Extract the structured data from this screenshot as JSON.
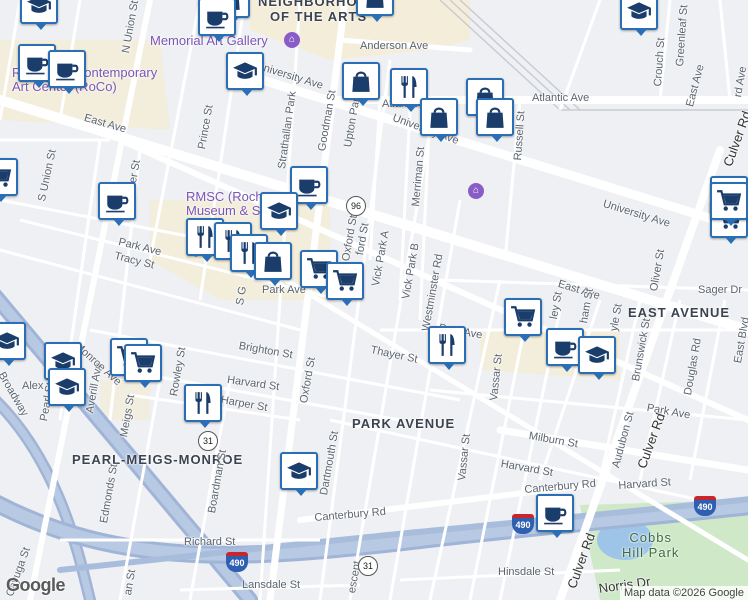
{
  "map": {
    "areas": [
      {
        "id": "neighborhood-of-the-arts",
        "text": "NEIGHBORHOOD\nOF THE ARTS"
      },
      {
        "id": "east-avenue",
        "text": "EAST AVENUE"
      },
      {
        "id": "park-avenue",
        "text": "PARK AVENUE"
      },
      {
        "id": "pearl-meigs-monroe",
        "text": "PEARL-MEIGS-MONROE"
      },
      {
        "id": "cobbs-hill-park",
        "text": "Cobbs\nHill Park"
      }
    ],
    "pois": [
      {
        "id": "memorial-art-gallery",
        "text": "Memorial Art Gallery"
      },
      {
        "id": "roco",
        "text": "Rochester Contemporary\nArt Center (RoCo)"
      },
      {
        "id": "rmsc",
        "text": "RMSC (Rochester\nMuseum & Science"
      }
    ],
    "streets": [
      {
        "id": "anderson-ave",
        "text": "Anderson Ave"
      },
      {
        "id": "university-ave-1",
        "text": "University Ave"
      },
      {
        "id": "university-ave-2",
        "text": "University Ave"
      },
      {
        "id": "university-ave-3",
        "text": "University Ave"
      },
      {
        "id": "atlantic-ave-1",
        "text": "Atlantic"
      },
      {
        "id": "atlantic-ave-2",
        "text": "Atlantic Ave"
      },
      {
        "id": "east-ave-1",
        "text": "East Ave"
      },
      {
        "id": "east-ave-2",
        "text": "East Ave"
      },
      {
        "id": "east-ave-3",
        "text": "East Ave"
      },
      {
        "id": "n-union-st",
        "text": "N Union St"
      },
      {
        "id": "s-union-st",
        "text": "S Union St"
      },
      {
        "id": "prince-st",
        "text": "Prince St"
      },
      {
        "id": "strathallan-park",
        "text": "Strathallan Park"
      },
      {
        "id": "goodman-st",
        "text": "Goodman St"
      },
      {
        "id": "upton-park",
        "text": "Upton Park"
      },
      {
        "id": "merriman-st",
        "text": "Merriman St"
      },
      {
        "id": "russell-st",
        "text": "Russell St"
      },
      {
        "id": "crouch-st",
        "text": "Crouch St"
      },
      {
        "id": "greenleaf-st",
        "text": "Greenleaf St"
      },
      {
        "id": "park-ave-1",
        "text": "Park Ave"
      },
      {
        "id": "park-ave-2",
        "text": "Park Ave"
      },
      {
        "id": "park-ave-3",
        "text": "Park Ave"
      },
      {
        "id": "tracy-st",
        "text": "Tracy St"
      },
      {
        "id": "vick-park-a",
        "text": "Vick Park A"
      },
      {
        "id": "vick-park-b",
        "text": "Vick Park B"
      },
      {
        "id": "westminster-rd",
        "text": "Westminster Rd"
      },
      {
        "id": "oxford-st-1",
        "text": "Oxford St"
      },
      {
        "id": "oxford-st-2",
        "text": "Oxford St"
      },
      {
        "id": "brighton-st",
        "text": "Brighton St"
      },
      {
        "id": "thayer-st",
        "text": "Thayer St"
      },
      {
        "id": "harvard-st-1",
        "text": "Harvard St"
      },
      {
        "id": "harvard-st-2",
        "text": "Harvard St"
      },
      {
        "id": "harvard-st-3",
        "text": "Harvard St"
      },
      {
        "id": "harper-st",
        "text": "Harper St"
      },
      {
        "id": "rowley-st",
        "text": "Rowley St"
      },
      {
        "id": "meigs-st",
        "text": "Meigs St"
      },
      {
        "id": "averill-ave",
        "text": "Averill Ave"
      },
      {
        "id": "pearl-st",
        "text": "Pearl St"
      },
      {
        "id": "monroe-ave",
        "text": "Monroe Ave"
      },
      {
        "id": "broadway",
        "text": "Broadway"
      },
      {
        "id": "vassar-st-1",
        "text": "Vassar St"
      },
      {
        "id": "vassar-st-2",
        "text": "Vassar St"
      },
      {
        "id": "milburn-st",
        "text": "Milburn St"
      },
      {
        "id": "canterbury-rd-1",
        "text": "Canterbury Rd"
      },
      {
        "id": "canterbury-rd-2",
        "text": "Canterbury Rd"
      },
      {
        "id": "edmonds-st",
        "text": "Edmonds St"
      },
      {
        "id": "boardman-st",
        "text": "Boardman St"
      },
      {
        "id": "dartmouth-st",
        "text": "Dartmouth St"
      },
      {
        "id": "richard-st",
        "text": "Richard St"
      },
      {
        "id": "lansdale-st",
        "text": "Lansdale St"
      },
      {
        "id": "hinsdale-st",
        "text": "Hinsdale St"
      },
      {
        "id": "norris-dr",
        "text": "Norris Dr"
      },
      {
        "id": "culver-rd-1",
        "text": "Culver Rd"
      },
      {
        "id": "culver-rd-2",
        "text": "Culver Rd"
      },
      {
        "id": "culver-rd-3",
        "text": "Culver Rd"
      },
      {
        "id": "audubon-st",
        "text": "Audubon St"
      },
      {
        "id": "brunswick-st",
        "text": "Brunswick St"
      },
      {
        "id": "douglas-rd",
        "text": "Douglas Rd"
      },
      {
        "id": "oliver-st",
        "text": "Oliver St"
      },
      {
        "id": "sager-dr",
        "text": "Sager Dr"
      },
      {
        "id": "east-blvd",
        "text": "East Blvd"
      },
      {
        "id": "s-goodman",
        "text": "S G"
      },
      {
        "id": "alex",
        "text": "Alex"
      },
      {
        "id": "cayuga",
        "text": "Cayuga St"
      },
      {
        "id": "crescent",
        "text": "escent"
      },
      {
        "id": "an-st",
        "text": "an St"
      },
      {
        "id": "ford-st",
        "text": "ford St"
      },
      {
        "id": "mu",
        "text": "M"
      },
      {
        "id": "der-st",
        "text": "der St"
      },
      {
        "id": "rd-ave",
        "text": "rd Ave"
      },
      {
        "id": "ley-st",
        "text": "ley St"
      },
      {
        "id": "ham-st",
        "text": "ham St"
      },
      {
        "id": "yle-st",
        "text": "yle St"
      },
      {
        "id": "park-ave-4",
        "text": "Park Ave"
      }
    ],
    "shields": [
      {
        "id": "route-96",
        "text": "96"
      },
      {
        "id": "route-31-1",
        "text": "31"
      },
      {
        "id": "route-31-2",
        "text": "31"
      },
      {
        "id": "i490-1",
        "text": "490"
      },
      {
        "id": "i490-2",
        "text": "490"
      },
      {
        "id": "i490-3",
        "text": "490"
      }
    ],
    "markers": [
      {
        "id": "m1",
        "icon": "school-icon"
      },
      {
        "id": "m2",
        "icon": "shopping-bag-icon"
      },
      {
        "id": "m3",
        "icon": "shopping-bag-icon"
      },
      {
        "id": "m4",
        "icon": "school-icon"
      },
      {
        "id": "m5",
        "icon": "cafe-icon"
      },
      {
        "id": "m6",
        "icon": "cafe-icon"
      },
      {
        "id": "m7",
        "icon": "school-icon"
      },
      {
        "id": "m8",
        "icon": "shopping-bag-icon"
      },
      {
        "id": "m9",
        "icon": "restaurant-icon"
      },
      {
        "id": "m10",
        "icon": "shopping-bag-icon"
      },
      {
        "id": "m11",
        "icon": "shopping-bag-icon"
      },
      {
        "id": "m12",
        "icon": "shopping-bag-icon"
      },
      {
        "id": "m13",
        "icon": "shopping-cart-icon"
      },
      {
        "id": "m14",
        "icon": "cafe-icon"
      },
      {
        "id": "m15",
        "icon": "cafe-icon"
      },
      {
        "id": "m16",
        "icon": "school-icon"
      },
      {
        "id": "m17",
        "icon": "shopping-bag-icon"
      },
      {
        "id": "m18",
        "icon": "restaurant-icon"
      },
      {
        "id": "m19",
        "icon": "restaurant-icon"
      },
      {
        "id": "m20",
        "icon": "restaurant-icon"
      },
      {
        "id": "m21",
        "icon": "shopping-bag-icon"
      },
      {
        "id": "m22",
        "icon": "shopping-cart-icon"
      },
      {
        "id": "m23",
        "icon": "shopping-cart-icon"
      },
      {
        "id": "m24",
        "icon": "school-icon"
      },
      {
        "id": "m25",
        "icon": "school-icon"
      },
      {
        "id": "m26",
        "icon": "school-icon"
      },
      {
        "id": "m27",
        "icon": "restaurant-icon"
      },
      {
        "id": "m28",
        "icon": "shopping-cart-icon"
      },
      {
        "id": "m29",
        "icon": "shopping-cart-icon"
      },
      {
        "id": "m30",
        "icon": "shopping-cart-icon"
      },
      {
        "id": "m31",
        "icon": "restaurant-icon"
      },
      {
        "id": "m32",
        "icon": "school-icon"
      },
      {
        "id": "m33",
        "icon": "cafe-icon"
      },
      {
        "id": "m34",
        "icon": "school-icon"
      },
      {
        "id": "m35",
        "icon": "shopping-cart-icon"
      },
      {
        "id": "m36",
        "icon": "cafe-icon"
      },
      {
        "id": "m37",
        "icon": "cafe-icon"
      },
      {
        "id": "m38",
        "icon": "shopping-cart-icon"
      }
    ]
  },
  "footer": {
    "logo": "Google",
    "attribution": "Map data ©2026 Google"
  }
}
